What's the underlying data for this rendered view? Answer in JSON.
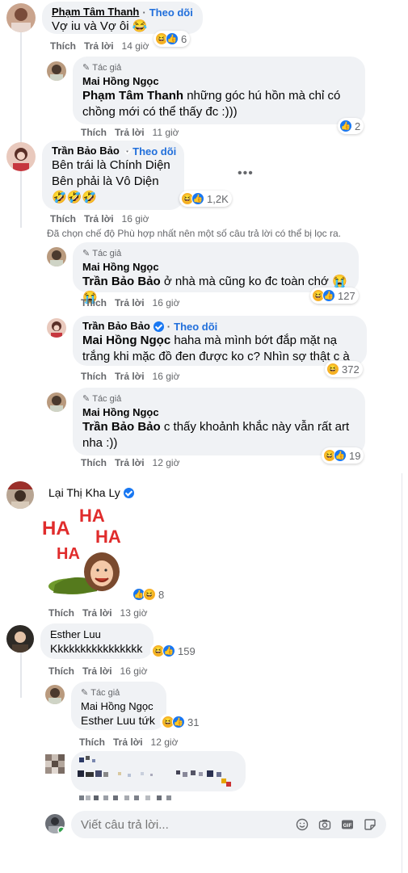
{
  "shot1": {
    "c1": {
      "name": "Phạm Tâm Thanh",
      "follow": "Theo dõi",
      "text": "Vợ iu và Vợ ôi 😂",
      "like": "Thích",
      "reply": "Trả lời",
      "time": "14 giờ",
      "count": "6"
    },
    "r1": {
      "tag": "Tác giả",
      "name": "Mai Hồng Ngọc",
      "mention": "Phạm Tâm Thanh",
      "text": " những góc hú hồn mà chỉ có chồng mới có thể thấy đc :)))",
      "like": "Thích",
      "reply": "Trả lời",
      "time": "11 giờ",
      "count": "2"
    },
    "c2": {
      "name": "Trần Bảo Bảo",
      "follow": "Theo dõi",
      "line1": "Bên trái là Chính Diện",
      "line2": "Bên phải là Vô Diện",
      "line3": "🤣🤣🤣",
      "like": "Thích",
      "reply": "Trả lời",
      "time": "16 giờ",
      "count": "1,2K"
    },
    "notice": "Đã chọn chế độ Phù hợp nhất nên một số câu trả lời có thể bị lọc ra.",
    "r2": {
      "tag": "Tác giả",
      "name": "Mai Hồng Ngọc",
      "mention": "Trần Bảo Bảo",
      "text": " ở nhà mà cũng ko đc toàn chớ 😭😭",
      "like": "Thích",
      "reply": "Trả lời",
      "time": "16 giờ",
      "count": "127"
    },
    "r3": {
      "name": "Trần Bảo Bảo",
      "follow": "Theo dõi",
      "mention": "Mai Hồng Ngọc",
      "text": " haha mà mình bớt đắp mặt nạ trắng khi mặc đồ đen được ko c? Nhìn sợ thật c à",
      "like": "Thích",
      "reply": "Trả lời",
      "time": "16 giờ",
      "count": "372"
    },
    "r4": {
      "tag": "Tác giả",
      "name": "Mai Hồng Ngọc",
      "mention": "Trần Bảo Bảo",
      "text": " c thấy khoảnh khắc này vẫn rất art nha :))",
      "like": "Thích",
      "reply": "Trả lời",
      "time": "12 giờ",
      "count": "19"
    }
  },
  "shot2": {
    "c1": {
      "name": "Lại Thị Kha Ly",
      "sticker_text": [
        "HA",
        "HA",
        "HA",
        "HA"
      ],
      "like": "Thích",
      "reply": "Trả lời",
      "time": "13 giờ",
      "count": "8"
    },
    "c2": {
      "name": "Esther Luu",
      "text": "Kkkkkkkkkkkkkkkk",
      "like": "Thích",
      "reply": "Trả lời",
      "time": "16 giờ",
      "count": "159"
    },
    "r1": {
      "tag": "Tác giả",
      "name": "Mai Hồng Ngọc",
      "mention": "Esther Luu",
      "text": " tứk",
      "like": "Thích",
      "reply": "Trả lời",
      "time": "12 giờ",
      "count": "31"
    },
    "input": {
      "placeholder": "Viết câu trả lời..."
    }
  },
  "colors": {
    "bubble": "#f0f2f5",
    "link": "#216fdb",
    "muted": "#65676b",
    "like_blue": "#1877f2",
    "haha_yellow": "#f7b125"
  },
  "icons": [
    "verified-badge-icon",
    "pen-icon",
    "haha-reaction-icon",
    "like-reaction-icon",
    "emoji-icon",
    "camera-icon",
    "gif-icon",
    "sticker-icon",
    "more-dots-icon"
  ]
}
